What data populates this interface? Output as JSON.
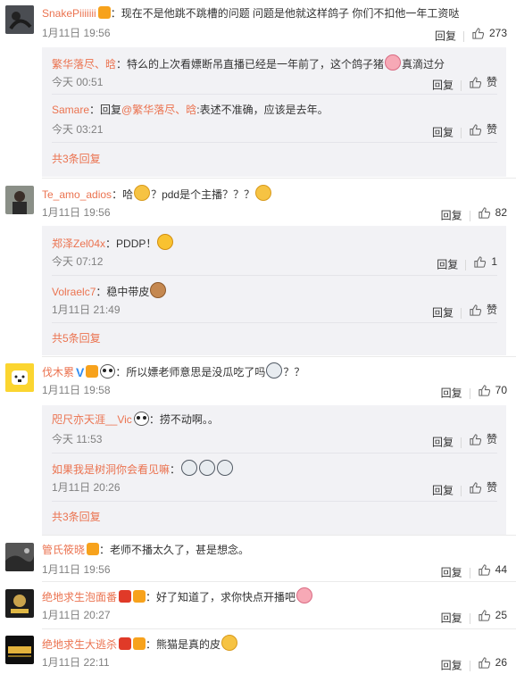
{
  "actions": {
    "reply": "回复",
    "like": "赞"
  },
  "comments": [
    {
      "user": "SnakePiiiiiii",
      "text": "：现在不是他跳不跳槽的问题 问题是他就这样鸽子 你们不扣他一年工资哒",
      "time": "1月11日 19:56",
      "likes": "273",
      "replies": [
        {
          "user": "繁华落尽、晗",
          "text_a": "：特么的上次看嫖断吊直播已经是一年前了，这个鸽子猪",
          "text_b": "真滴过分",
          "time": "今天 00:51",
          "likes": "赞"
        },
        {
          "user": "Samare",
          "text_a": "：回复",
          "mention": "@繁华落尽、晗",
          "text_b": ":表述不准确，应该是去年。",
          "time": "今天 03:21",
          "likes": "赞"
        }
      ],
      "more": "共3条回复"
    },
    {
      "user": "Te_amo_adios",
      "text_a": "：哈",
      "text_b": "？pdd是个主播？？？",
      "time": "1月11日 19:56",
      "likes": "82",
      "replies": [
        {
          "user": "郑泽Zel04x",
          "text_a": "：PDDP！",
          "time": "今天 07:12",
          "likes": "1"
        },
        {
          "user": "Volraelc7",
          "text_a": "：稳中带皮",
          "time": "1月11日 21:49",
          "likes": "赞"
        }
      ],
      "more": "共5条回复"
    },
    {
      "user": "伐木累",
      "vmark": "V",
      "text_a": "：所以嫖老师意思是没瓜吃了吗",
      "text_b": "？？",
      "time": "1月11日 19:58",
      "likes": "70",
      "replies": [
        {
          "user": "咫尺亦天涯__Vic",
          "text_a": "：捞不动啊。。",
          "time": "今天 11:53",
          "likes": "赞"
        },
        {
          "user": "如果我是树洞你会看见嘛",
          "text_a": "：",
          "time": "1月11日 20:26",
          "likes": "赞"
        }
      ],
      "more": "共3条回复"
    },
    {
      "user": "管氏筱晓",
      "text_a": "：老师不播太久了，甚是想念。",
      "time": "1月11日 19:56",
      "likes": "44"
    },
    {
      "user": "绝地求生泡面番",
      "text_a": "：好了知道了，求你快点开播吧",
      "time": "1月11日 20:27",
      "likes": "25"
    },
    {
      "user": "绝地求生大逃杀",
      "text_a": "：熊猫是真的皮",
      "time": "1月11日 22:11",
      "likes": "26"
    }
  ]
}
